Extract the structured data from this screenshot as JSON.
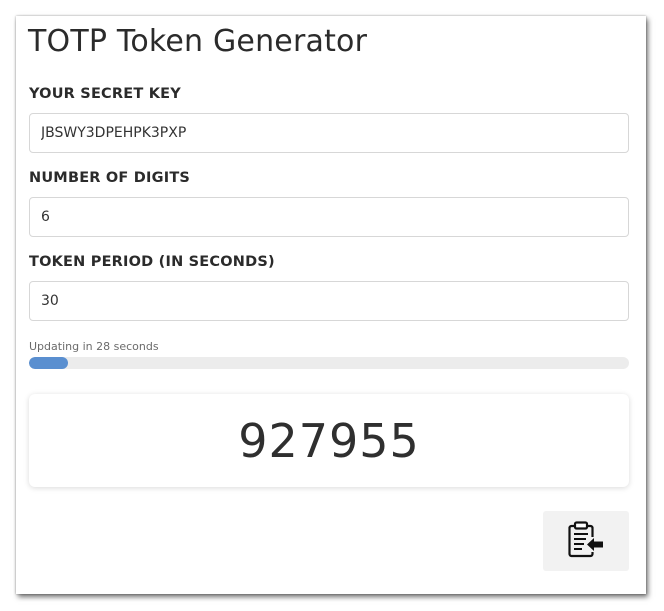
{
  "app": {
    "title": "TOTP Token Generator"
  },
  "form": {
    "secret_label": "YOUR SECRET KEY",
    "secret_value": "JBSWY3DPEHPK3PXP",
    "digits_label": "NUMBER OF DIGITS",
    "digits_value": "6",
    "period_label": "TOKEN PERIOD (IN SECONDS)",
    "period_value": "30"
  },
  "progress": {
    "text": "Updating in 28 seconds",
    "fraction": 0.065,
    "color": "#5a8fd0"
  },
  "token": {
    "value": "927955"
  },
  "copy_button": {
    "icon": "clipboard-copy-icon"
  }
}
